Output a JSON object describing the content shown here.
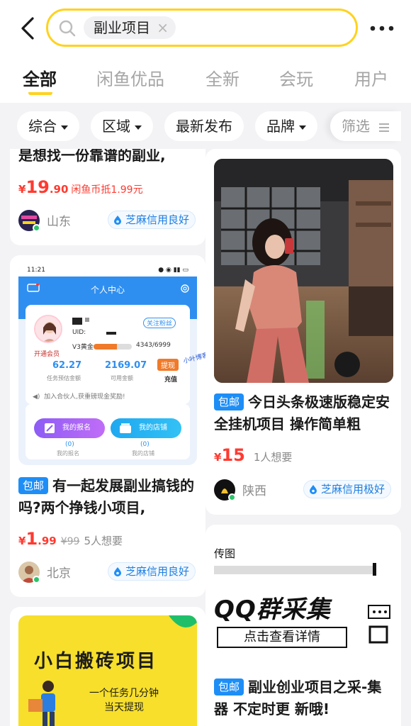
{
  "search": {
    "query": "副业项目"
  },
  "tabs": [
    {
      "label": "全部"
    },
    {
      "label": "闲鱼优品"
    },
    {
      "label": "全新"
    },
    {
      "label": "会玩"
    },
    {
      "label": "用户"
    }
  ],
  "filters": [
    {
      "label": "综合"
    },
    {
      "label": "区域"
    },
    {
      "label": "最新发布"
    },
    {
      "label": "品牌"
    },
    {
      "label": "筛选"
    }
  ],
  "items": [
    {
      "title_tail": "是想找一份靠谱的副业,",
      "price_yen": "¥",
      "price_int": "19",
      "price_dec": ".90",
      "coin_note": "闲鱼币抵1.99元",
      "location": "山东",
      "credit": "芝麻信用良好"
    },
    {
      "tag": "包邮",
      "title": "有一起发展副业搞钱的吗?两个挣钱小项目,",
      "price_yen": "¥",
      "price_int": "1",
      "price_dec": ".99",
      "orig_price": "¥99",
      "wants": "5人想要",
      "location": "北京",
      "credit": "芝麻信用良好"
    },
    {
      "tag": "包邮",
      "title": "今日头条极速版稳定安全挂机项目 操作简单粗",
      "price_yen": "¥",
      "price_int": "15",
      "wants": "1人想要",
      "location": "陕西",
      "credit": "芝麻信用极好"
    },
    {
      "tag": "包邮",
      "title": "副业创业项目之采-集器 不定时更 新哦!"
    }
  ],
  "phone_screenshot": {
    "time": "11:21",
    "header": "个人中心",
    "uid": "UID:",
    "follow": "关注粉丝",
    "member": "开通会员",
    "level": "V3黄金",
    "progress": "4343/6999",
    "progress_fraction": 0.62,
    "estimated": "62.27",
    "estimated_label": "任务预估金额",
    "available": "2169.07",
    "available_label": "可用金额",
    "withdraw": "提现",
    "recharge": "充值",
    "invite": "加入合伙人,获重磅现金奖励!",
    "my_signup": "我的报名",
    "my_shop": "我的店铺",
    "count_a": "(0)",
    "count_b": "(0)",
    "watermark": "小叶博客"
  },
  "yellow_poster": {
    "title": "小白搬砖项目",
    "line1": "一个任务几分钟",
    "line2": "当天提现"
  },
  "qq_poster": {
    "corner": "传图",
    "title": "QQ群采集",
    "button": "点击查看详情"
  }
}
